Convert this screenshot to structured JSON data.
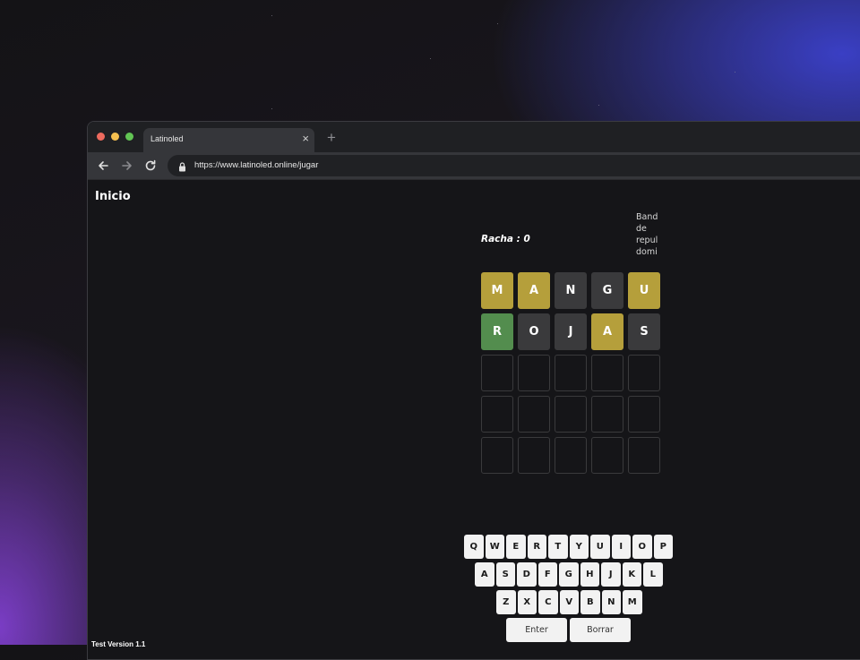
{
  "browser": {
    "tab_title": "Latinoled",
    "tab_close": "×",
    "new_tab": "+",
    "url": "https://www.latinoled.online/jugar"
  },
  "page": {
    "nav_home": "Inicio",
    "flag_alt_text": "Band de repul domi",
    "streak_label": "Racha : 0",
    "version": "Test Version 1.1"
  },
  "board": {
    "rows": [
      [
        {
          "letter": "M",
          "state": "yellow"
        },
        {
          "letter": "A",
          "state": "yellow"
        },
        {
          "letter": "N",
          "state": "gray"
        },
        {
          "letter": "G",
          "state": "gray"
        },
        {
          "letter": "U",
          "state": "yellow"
        }
      ],
      [
        {
          "letter": "R",
          "state": "green"
        },
        {
          "letter": "O",
          "state": "gray"
        },
        {
          "letter": "J",
          "state": "gray"
        },
        {
          "letter": "A",
          "state": "yellow"
        },
        {
          "letter": "S",
          "state": "gray"
        }
      ],
      [
        {
          "letter": "",
          "state": "empty"
        },
        {
          "letter": "",
          "state": "empty"
        },
        {
          "letter": "",
          "state": "empty"
        },
        {
          "letter": "",
          "state": "empty"
        },
        {
          "letter": "",
          "state": "empty"
        }
      ],
      [
        {
          "letter": "",
          "state": "empty"
        },
        {
          "letter": "",
          "state": "empty"
        },
        {
          "letter": "",
          "state": "empty"
        },
        {
          "letter": "",
          "state": "empty"
        },
        {
          "letter": "",
          "state": "empty"
        }
      ],
      [
        {
          "letter": "",
          "state": "empty"
        },
        {
          "letter": "",
          "state": "empty"
        },
        {
          "letter": "",
          "state": "empty"
        },
        {
          "letter": "",
          "state": "empty"
        },
        {
          "letter": "",
          "state": "empty"
        }
      ]
    ]
  },
  "keyboard": {
    "row1": [
      "Q",
      "W",
      "E",
      "R",
      "T",
      "Y",
      "U",
      "I",
      "O",
      "P"
    ],
    "row2": [
      "A",
      "S",
      "D",
      "F",
      "G",
      "H",
      "J",
      "K",
      "L"
    ],
    "row3": [
      "Z",
      "X",
      "C",
      "V",
      "B",
      "N",
      "M"
    ],
    "enter": "Enter",
    "delete": "Borrar"
  },
  "colors": {
    "yellow": "#b59f3b",
    "green": "#538d4e",
    "gray": "#3a3a3c",
    "background": "#151518"
  }
}
